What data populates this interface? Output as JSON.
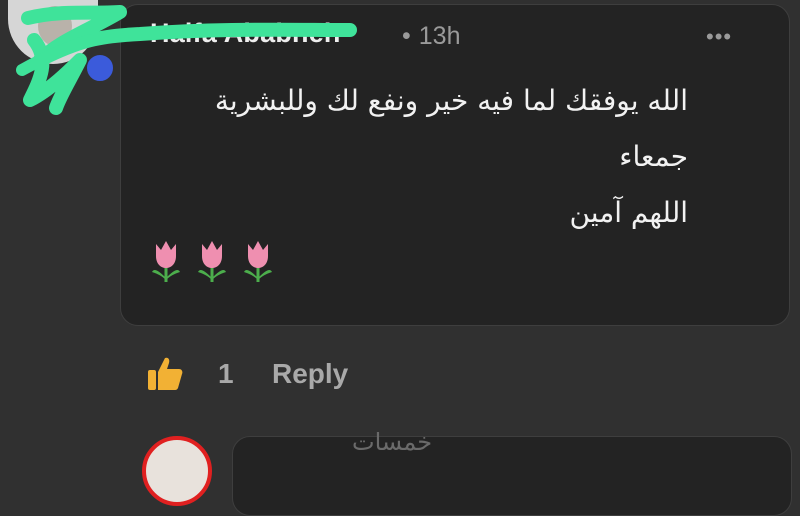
{
  "comment": {
    "author": "Haifa Ababneh",
    "time": "13h",
    "separator": "•",
    "more_icon": "•••",
    "lines": [
      "الله يوفقك لما فيه خير ونفع لك وللبشرية",
      "جمعاء",
      "اللهم آمين"
    ],
    "emoji_icons": [
      "tulip-icon",
      "tulip-icon",
      "tulip-icon"
    ]
  },
  "actions": {
    "like_icon": "thumbs-up-icon",
    "like_count": "1",
    "reply_label": "Reply"
  },
  "watermark": "خمسات",
  "colors": {
    "background": "#303030",
    "bubble": "#232323",
    "scribble": "#3fe39a",
    "like": "#f2b134",
    "tulip": "#ef8fb0"
  }
}
